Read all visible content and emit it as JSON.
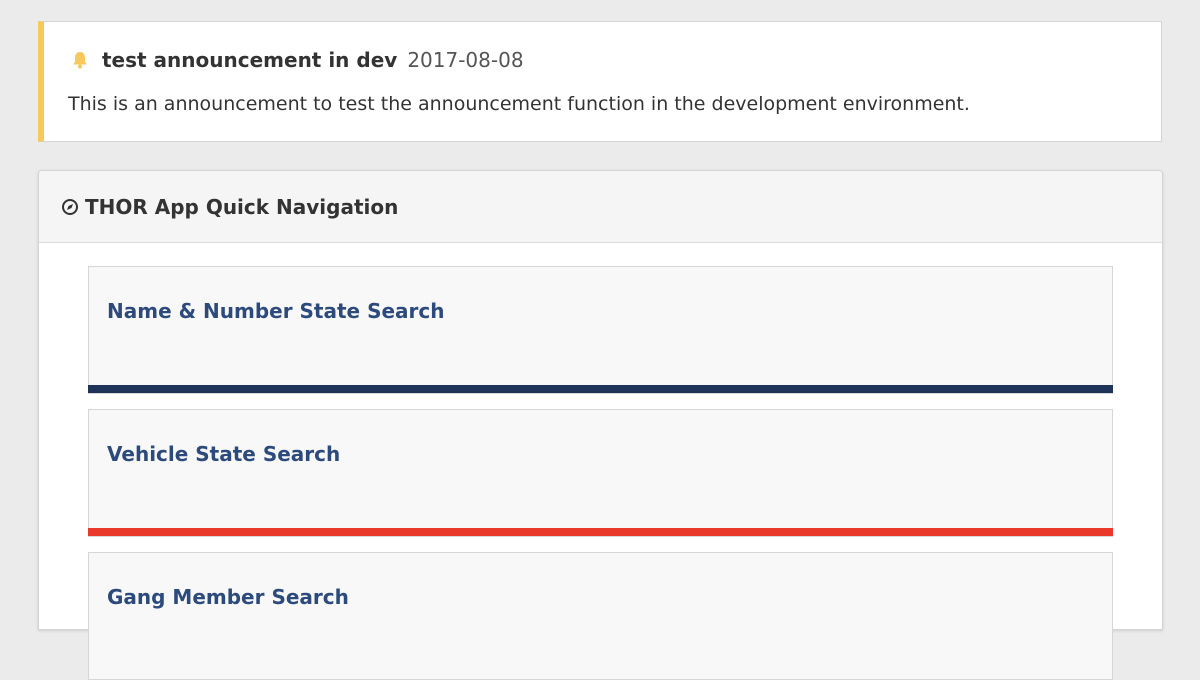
{
  "announcement": {
    "icon": "bell-icon",
    "title": "test announcement in dev",
    "date": "2017-08-08",
    "body": "This is an announcement to test the announcement function in the development environment.",
    "accent_color": "#f7c85c"
  },
  "quick_nav": {
    "icon": "compass-icon",
    "title": "THOR App Quick Navigation",
    "cards": [
      {
        "label": "Name & Number State Search",
        "bar_color": "#1d3458"
      },
      {
        "label": "Vehicle State Search",
        "bar_color": "#e8392a"
      },
      {
        "label": "Gang Member Search",
        "bar_color": ""
      }
    ]
  }
}
